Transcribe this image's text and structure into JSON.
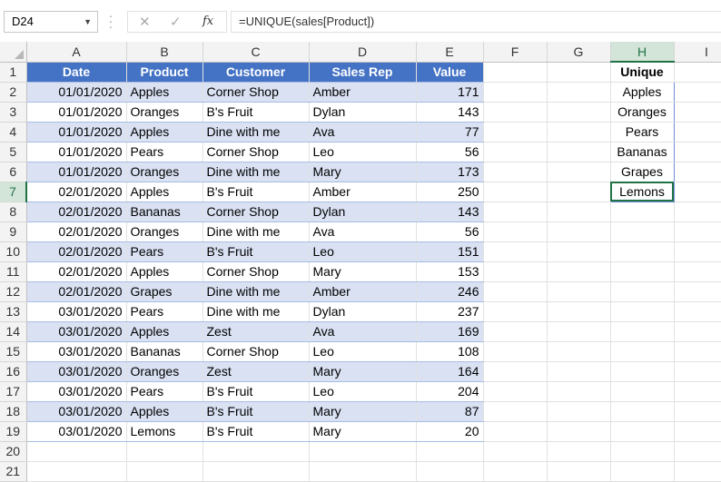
{
  "formula_bar": {
    "name_box": "D24",
    "cancel_icon": "✕",
    "enter_icon": "✓",
    "fx_label": "fx",
    "formula": "=UNIQUE(sales[Product])"
  },
  "columns": [
    "A",
    "B",
    "C",
    "D",
    "E",
    "F",
    "G",
    "H",
    "I"
  ],
  "selected_column": "H",
  "selected_row": 7,
  "table": {
    "headers": [
      "Date",
      "Product",
      "Customer",
      "Sales Rep",
      "Value"
    ],
    "rows": [
      [
        "01/01/2020",
        "Apples",
        "Corner Shop",
        "Amber",
        "171"
      ],
      [
        "01/01/2020",
        "Oranges",
        "B's Fruit",
        "Dylan",
        "143"
      ],
      [
        "01/01/2020",
        "Apples",
        "Dine with me",
        "Ava",
        "77"
      ],
      [
        "01/01/2020",
        "Pears",
        "Corner Shop",
        "Leo",
        "56"
      ],
      [
        "01/01/2020",
        "Oranges",
        "Dine with me",
        "Mary",
        "173"
      ],
      [
        "02/01/2020",
        "Apples",
        "B's Fruit",
        "Amber",
        "250"
      ],
      [
        "02/01/2020",
        "Bananas",
        "Corner Shop",
        "Dylan",
        "143"
      ],
      [
        "02/01/2020",
        "Oranges",
        "Dine with me",
        "Ava",
        "56"
      ],
      [
        "02/01/2020",
        "Pears",
        "B's Fruit",
        "Leo",
        "151"
      ],
      [
        "02/01/2020",
        "Apples",
        "Corner Shop",
        "Mary",
        "153"
      ],
      [
        "02/01/2020",
        "Grapes",
        "Dine with me",
        "Amber",
        "246"
      ],
      [
        "03/01/2020",
        "Pears",
        "Dine with me",
        "Dylan",
        "237"
      ],
      [
        "03/01/2020",
        "Apples",
        "Zest",
        "Ava",
        "169"
      ],
      [
        "03/01/2020",
        "Bananas",
        "Corner Shop",
        "Leo",
        "108"
      ],
      [
        "03/01/2020",
        "Oranges",
        "Zest",
        "Mary",
        "164"
      ],
      [
        "03/01/2020",
        "Pears",
        "B's Fruit",
        "Leo",
        "204"
      ],
      [
        "03/01/2020",
        "Apples",
        "B's Fruit",
        "Mary",
        "87"
      ],
      [
        "03/01/2020",
        "Lemons",
        "B's Fruit",
        "Mary",
        "20"
      ]
    ]
  },
  "unique": {
    "title": "Unique",
    "values": [
      "Apples",
      "Oranges",
      "Pears",
      "Bananas",
      "Grapes",
      "Lemons"
    ]
  },
  "visible_row_count": 21,
  "colors": {
    "table_header": "#4472c4",
    "band": "#d9e1f2",
    "excel_green": "#217346"
  }
}
